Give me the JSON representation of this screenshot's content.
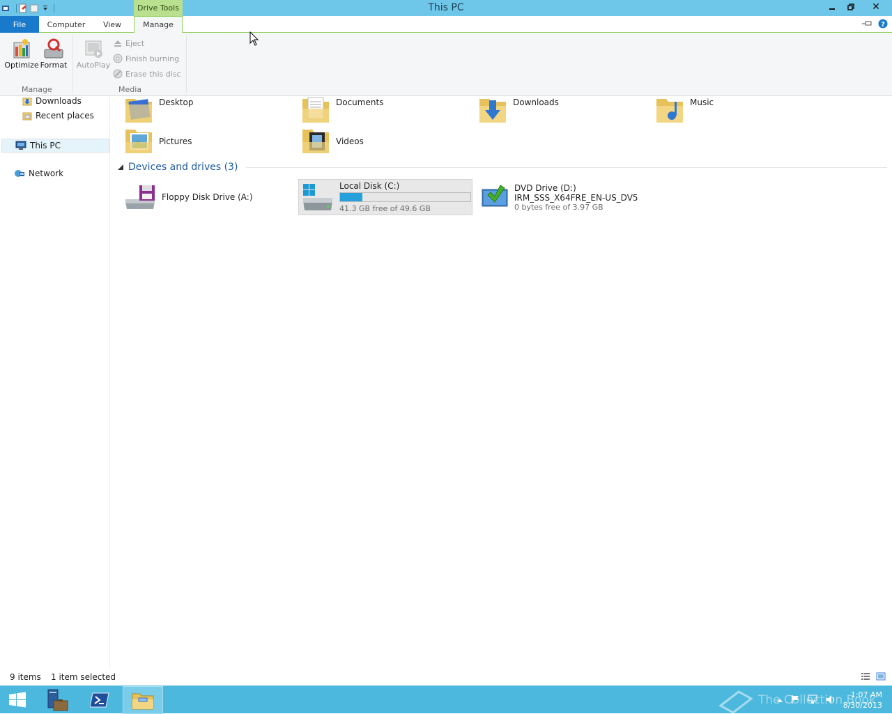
{
  "window": {
    "title": "This PC",
    "context_tab": "Drive Tools"
  },
  "tabs": {
    "file": "File",
    "computer": "Computer",
    "view": "View",
    "manage": "Manage"
  },
  "ribbon": {
    "optimize": "Optimize",
    "format": "Format",
    "autoplay": "AutoPlay",
    "eject": "Eject",
    "finish_burning": "Finish burning",
    "erase_disc": "Erase this disc",
    "group_manage": "Manage",
    "group_media": "Media"
  },
  "nav": {
    "downloads": "Downloads",
    "recent_places": "Recent places",
    "this_pc": "This PC",
    "network": "Network"
  },
  "folders": [
    "Desktop",
    "Documents",
    "Downloads",
    "Music",
    "Pictures",
    "Videos"
  ],
  "devices": {
    "header": "Devices and drives (3)",
    "floppy": {
      "name": "Floppy Disk Drive (A:)"
    },
    "local_disk": {
      "name": "Local Disk (C:)",
      "free": "41.3 GB free of 49.6 GB",
      "used_fraction": 0.17
    },
    "dvd": {
      "name": "DVD Drive (D:)",
      "label": "IRM_SSS_X64FRE_EN-US_DV5",
      "free": "0 bytes free of 3.97 GB"
    }
  },
  "status": {
    "items": "9 items",
    "selected": "1 item selected"
  },
  "clock": {
    "time": "1:07 AM",
    "date": "8/30/2013"
  },
  "watermark": "The Collection Book",
  "colors": {
    "title_bar": "#6ec6e9",
    "file_tab": "#1979ca",
    "context_tab": "#b9e08f",
    "taskbar": "#4db8dd",
    "disk_bar": "#26a0da"
  }
}
